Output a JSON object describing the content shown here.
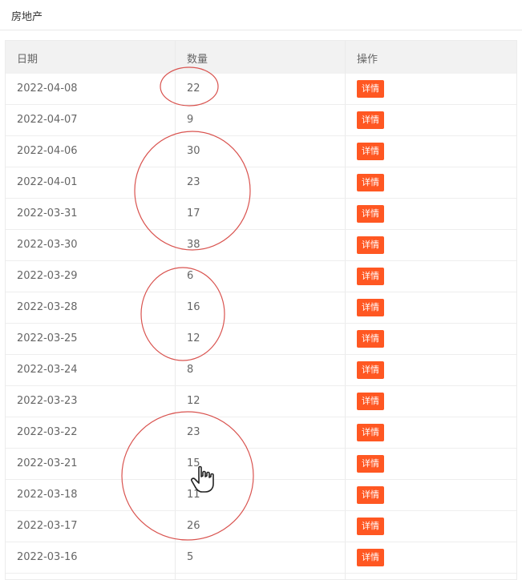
{
  "header": {
    "title": "房地产"
  },
  "table": {
    "columns": {
      "date": "日期",
      "quantity": "数量",
      "action": "操作"
    },
    "detail_label": "详情",
    "rows": [
      {
        "date": "2022-04-08",
        "quantity": "22"
      },
      {
        "date": "2022-04-07",
        "quantity": "9"
      },
      {
        "date": "2022-04-06",
        "quantity": "30"
      },
      {
        "date": "2022-04-01",
        "quantity": "23"
      },
      {
        "date": "2022-03-31",
        "quantity": "17"
      },
      {
        "date": "2022-03-30",
        "quantity": "38"
      },
      {
        "date": "2022-03-29",
        "quantity": "6"
      },
      {
        "date": "2022-03-28",
        "quantity": "16"
      },
      {
        "date": "2022-03-25",
        "quantity": "12"
      },
      {
        "date": "2022-03-24",
        "quantity": "8"
      },
      {
        "date": "2022-03-23",
        "quantity": "12"
      },
      {
        "date": "2022-03-22",
        "quantity": "23"
      },
      {
        "date": "2022-03-21",
        "quantity": "15"
      },
      {
        "date": "2022-03-18",
        "quantity": "11"
      },
      {
        "date": "2022-03-17",
        "quantity": "26"
      },
      {
        "date": "2022-03-16",
        "quantity": "5"
      }
    ]
  },
  "colors": {
    "detail_button": "#ff5722",
    "annotation": "#d9534f",
    "header_bg": "#f2f2f2"
  },
  "icons": {
    "cursor": "hand-pointer-icon"
  }
}
